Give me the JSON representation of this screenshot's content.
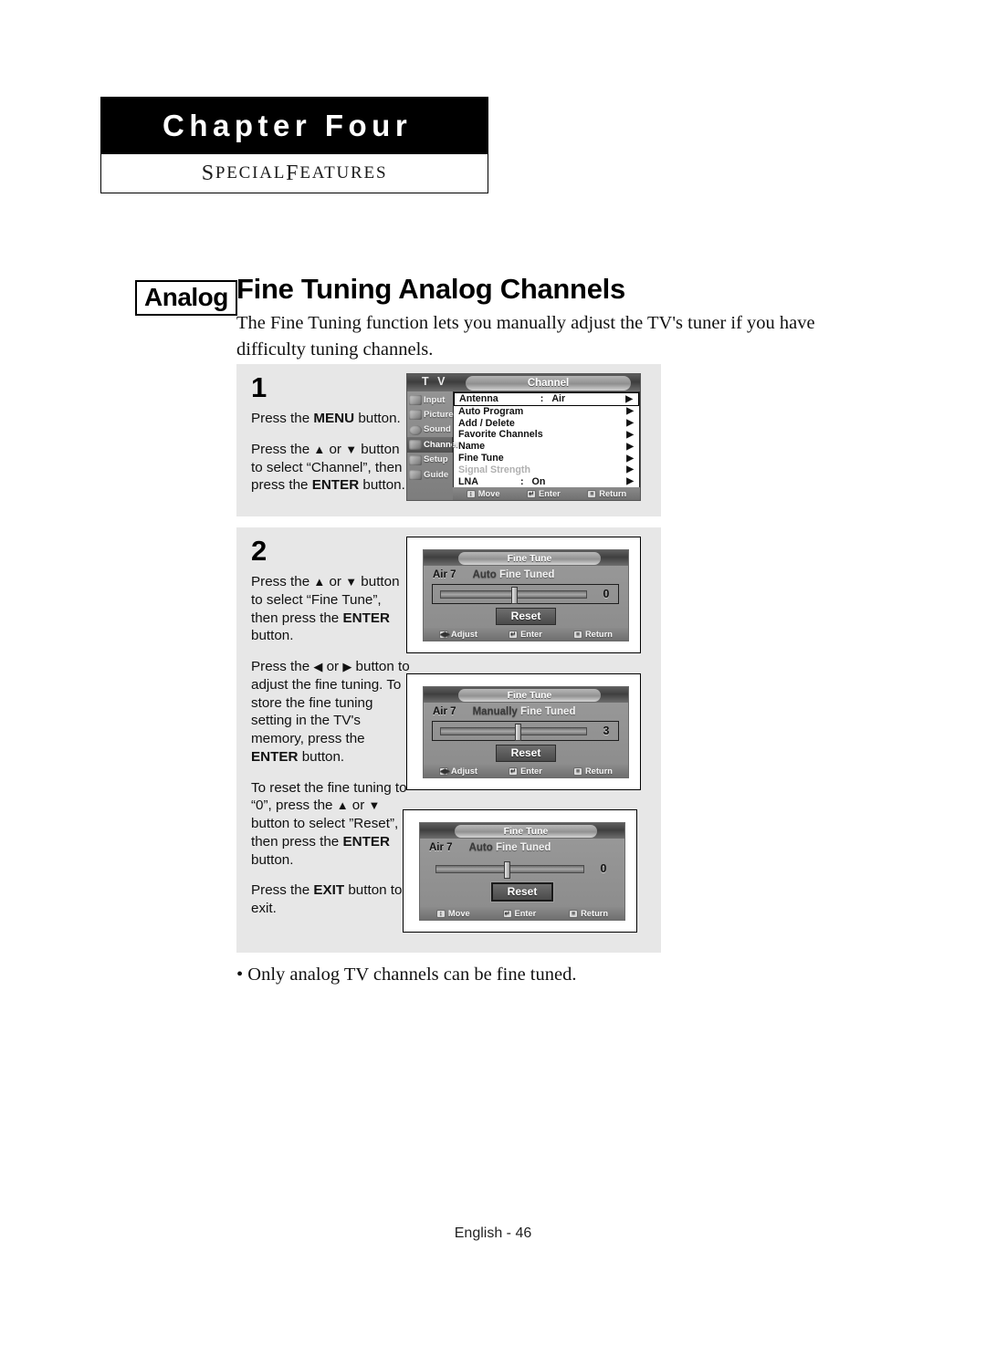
{
  "chapter": {
    "title": "Chapter Four",
    "subtitle": "Special Features",
    "subtitle_first": "S",
    "subtitle_rest": "PECIAL ",
    "subtitle_first2": "F",
    "subtitle_rest2": "EATURES"
  },
  "heading": {
    "badge": "Analog",
    "title": "Fine Tuning Analog Channels",
    "intro": "The Fine Tuning function lets you manually adjust the TV's tuner if you have difficulty tuning channels."
  },
  "step1": {
    "number": "1",
    "para1_pre": "Press the ",
    "para1_bold": "MENU",
    "para1_post": " button.",
    "para2_pre": "Press the ",
    "para2_up": "▲",
    "para2_or": " or ",
    "para2_down": "▼",
    "para2_mid": " button to select “Channel”, then press the ",
    "para2_bold": "ENTER",
    "para2_post": " button."
  },
  "tv_menu": {
    "brand": "T V",
    "title": "Channel",
    "sidebar": [
      {
        "label": "Input",
        "icon": "input-icon",
        "selected": false
      },
      {
        "label": "Picture",
        "icon": "picture-icon",
        "selected": false
      },
      {
        "label": "Sound",
        "icon": "sound-icon",
        "selected": false
      },
      {
        "label": "Channel",
        "icon": "channel-icon",
        "selected": true
      },
      {
        "label": "Setup",
        "icon": "setup-icon",
        "selected": false
      },
      {
        "label": "Guide",
        "icon": "guide-icon",
        "selected": false
      }
    ],
    "rows": [
      {
        "name": "Antenna",
        "value": "Air",
        "colon": ":",
        "highlighted": true,
        "dim": false
      },
      {
        "name": "Auto Program",
        "value": "",
        "colon": "",
        "highlighted": false,
        "dim": false
      },
      {
        "name": "Add / Delete",
        "value": "",
        "colon": "",
        "highlighted": false,
        "dim": false
      },
      {
        "name": "Favorite Channels",
        "value": "",
        "colon": "",
        "highlighted": false,
        "dim": false
      },
      {
        "name": "Name",
        "value": "",
        "colon": "",
        "highlighted": false,
        "dim": false
      },
      {
        "name": "Fine Tune",
        "value": "",
        "colon": "",
        "highlighted": false,
        "dim": false
      },
      {
        "name": "Signal Strength",
        "value": "",
        "colon": "",
        "highlighted": false,
        "dim": true
      },
      {
        "name": "LNA",
        "value": "On",
        "colon": ":",
        "highlighted": false,
        "dim": false
      }
    ],
    "arrow": "▶",
    "footer": [
      {
        "icon": "↕",
        "label": "Move"
      },
      {
        "icon": "↵",
        "label": "Enter"
      },
      {
        "icon": "≡",
        "label": "Return"
      }
    ]
  },
  "step2": {
    "number": "2",
    "p1_pre": "Press the ",
    "p1_up": "▲",
    "p1_or": " or ",
    "p1_down": "▼",
    "p1_mid": " button to select “Fine Tune”, then press the ",
    "p1_bold": "ENTER",
    "p1_post": " button.",
    "p2_pre": "Press the ",
    "p2_left": "◀",
    "p2_or": " or ",
    "p2_right": "▶",
    "p2_mid": " button to adjust the fine tuning. To store the fine tuning setting in the TV's memory, press the ",
    "p2_bold": "ENTER",
    "p2_post": " button.",
    "p3_pre": "To reset the fine tuning to “0”, press the ",
    "p3_up": "▲",
    "p3_or": " or ",
    "p3_down": "▼",
    "p3_mid": " button to select ”Reset”, then press the ",
    "p3_bold": "ENTER",
    "p3_post": " button.",
    "p4_pre": "Press the ",
    "p4_bold": "EXIT",
    "p4_post": " button to exit."
  },
  "fine_tune_panels": [
    {
      "title": "Fine Tune",
      "channel": "Air 7",
      "mode_a": "Auto",
      "mode_b": " Fine Tuned",
      "value": "0",
      "knob_percent": 50,
      "slider_boxed": true,
      "reset_label": "Reset",
      "reset_selected": false,
      "footer": [
        {
          "icon": "◀▶",
          "label": "Adjust"
        },
        {
          "icon": "↵",
          "label": "Enter"
        },
        {
          "icon": "≡",
          "label": "Return"
        }
      ]
    },
    {
      "title": "Fine Tune",
      "channel": "Air 7",
      "mode_a": "Manually",
      "mode_b": " Fine Tuned",
      "value": "3",
      "knob_percent": 53,
      "slider_boxed": true,
      "reset_label": "Reset",
      "reset_selected": false,
      "footer": [
        {
          "icon": "◀▶",
          "label": "Adjust"
        },
        {
          "icon": "↵",
          "label": "Enter"
        },
        {
          "icon": "≡",
          "label": "Return"
        }
      ]
    },
    {
      "title": "Fine Tune",
      "channel": "Air 7",
      "mode_a": "Auto",
      "mode_b": " Fine Tuned",
      "value": "0",
      "knob_percent": 48,
      "slider_boxed": false,
      "reset_label": "Reset",
      "reset_selected": true,
      "footer": [
        {
          "icon": "↕",
          "label": "Move"
        },
        {
          "icon": "↵",
          "label": "Enter"
        },
        {
          "icon": "≡",
          "label": "Return"
        }
      ]
    }
  ],
  "note": "• Only analog TV channels can be fine tuned.",
  "footer_text": "English - 46"
}
